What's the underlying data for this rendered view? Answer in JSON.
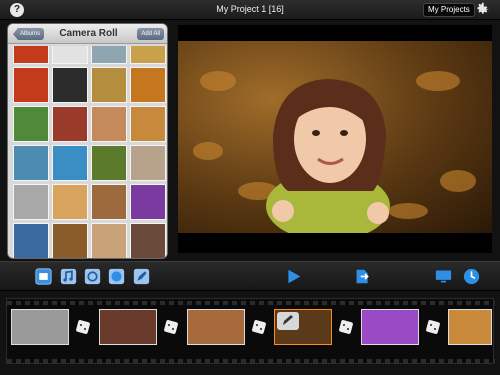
{
  "topbar": {
    "help_label": "?",
    "title": "My Project 1  [16]",
    "my_projects_label": "My Projects",
    "gear_icon": "gear-icon"
  },
  "camera_roll": {
    "back_label": "Albums",
    "title": "Camera Roll",
    "add_all_label": "Add All",
    "thumbnails": [
      "#c43b1c",
      "#e2e2e2",
      "#8fa5b2",
      "#c9a14a",
      "#c43b1c",
      "#2c2c2c",
      "#b58d3f",
      "#c4771f",
      "#4f8a3a",
      "#9a3a2a",
      "#c48a5c",
      "#c78a3c",
      "#4c8cb2",
      "#3a8ec4",
      "#5b7a2c",
      "#b7a28c",
      "#a8a8a8",
      "#d8a35c",
      "#9c6a3c",
      "#7a3aa0",
      "#3b6aa0",
      "#8a5c2a",
      "#c9a27a",
      "#6a4a3a"
    ]
  },
  "toolbar": {
    "play_icon": "play-icon",
    "export_icon": "export-icon",
    "display_icon": "display-icon",
    "clock_icon": "clock-icon"
  },
  "timeline": {
    "clips": [
      "#9a9a9a",
      "#6a3a2c",
      "#a66a3c",
      "#5a3a18",
      "#9a4ac4",
      "#c98a3c"
    ]
  },
  "colors": {
    "accent": "#2e8fe6",
    "selection": "#ff8a1e"
  }
}
